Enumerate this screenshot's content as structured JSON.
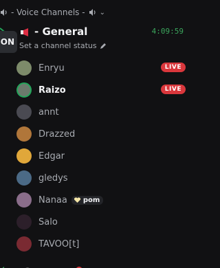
{
  "category": {
    "label": "- Voice Channels -"
  },
  "tooltip": {
    "text": "ON"
  },
  "channel": {
    "name": "- General",
    "timer": "4:09:59",
    "status_placeholder": "Set a channel status"
  },
  "members": [
    {
      "name": "Enryu",
      "live": "LIVE",
      "avatar_color": "#7d8b6a"
    },
    {
      "name": "Raizo",
      "live": "LIVE",
      "avatar_color": "#6b7a6c",
      "speaking": true
    },
    {
      "name": "annt",
      "avatar_color": "#4a4a52"
    },
    {
      "name": "Drazzed",
      "avatar_color": "#b0763a"
    },
    {
      "name": "Edgar",
      "avatar_color": "#e0a73a"
    },
    {
      "name": "gledys",
      "avatar_color": "#4b6a86"
    },
    {
      "name": "Nanaa",
      "tag": "pom",
      "avatar_color": "#8a6d8a"
    },
    {
      "name": "Salo",
      "avatar_color": "#2c1f2a"
    },
    {
      "name": "TAVOO[t]",
      "avatar_color": "#7a2a32"
    }
  ],
  "colors": {
    "background": "#111113",
    "live": "#da373c",
    "timer": "#3ba55c",
    "speaking_ring": "#23a55a"
  }
}
